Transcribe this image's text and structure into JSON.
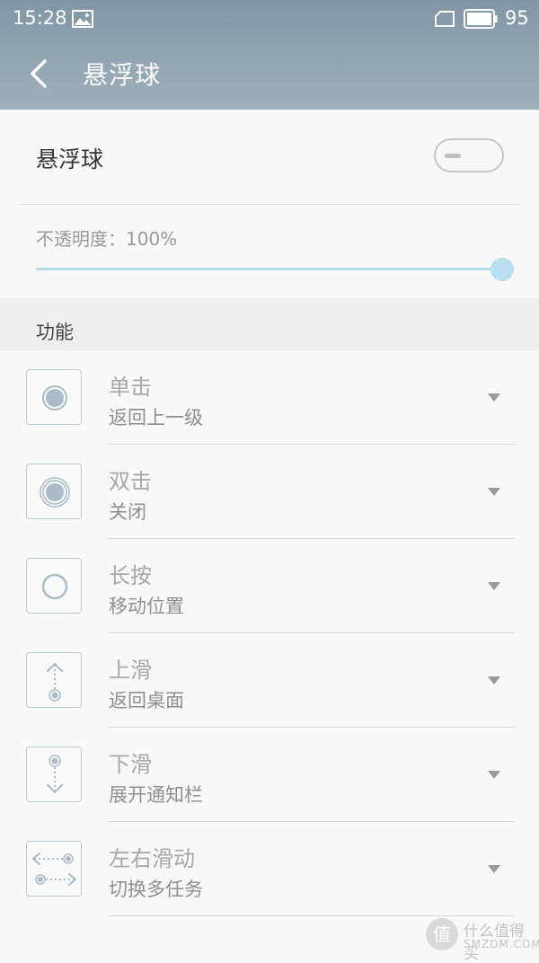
{
  "status_bar": {
    "time": "15:28",
    "battery_level": "95"
  },
  "app_bar": {
    "title": "悬浮球"
  },
  "toggle_row": {
    "label": "悬浮球"
  },
  "opacity": {
    "label": "不透明度：100%",
    "value_percent": 100
  },
  "section": {
    "label": "功能"
  },
  "items": [
    {
      "title": "单击",
      "subtitle": "返回上一级",
      "icon": "single-tap-icon"
    },
    {
      "title": "双击",
      "subtitle": "关闭",
      "icon": "double-tap-icon"
    },
    {
      "title": "长按",
      "subtitle": "移动位置",
      "icon": "long-press-icon"
    },
    {
      "title": "上滑",
      "subtitle": "返回桌面",
      "icon": "swipe-up-icon"
    },
    {
      "title": "下滑",
      "subtitle": "展开通知栏",
      "icon": "swipe-down-icon"
    },
    {
      "title": "左右滑动",
      "subtitle": "切换多任务",
      "icon": "swipe-left-right-icon"
    }
  ],
  "watermark": {
    "text": "什么值得买",
    "url": "SMZDM.COM",
    "logo_char": "值"
  },
  "colors": {
    "header": "#8aa0ae",
    "accent": "#b8def0",
    "icon_stroke": "#a9bcc7"
  }
}
